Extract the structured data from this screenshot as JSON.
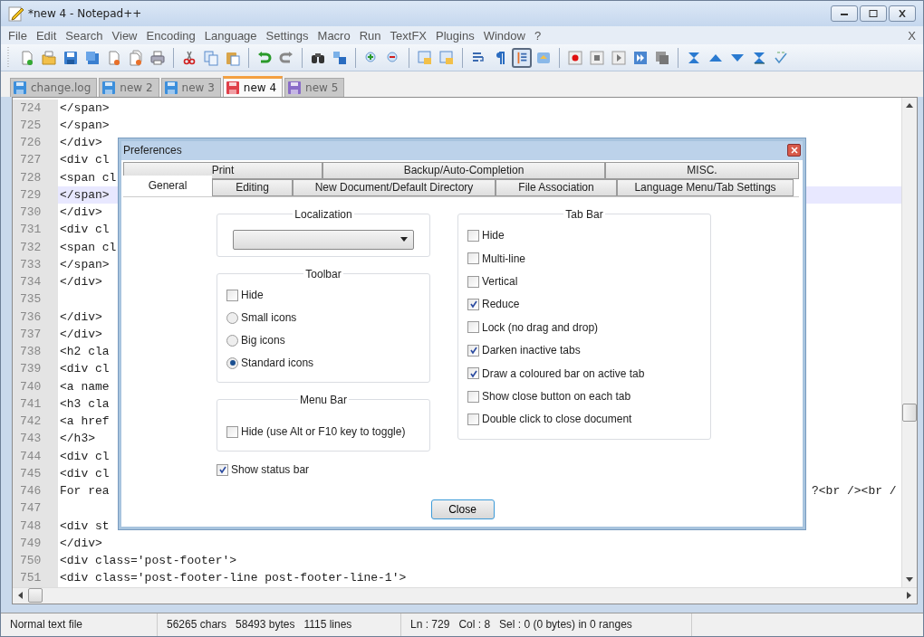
{
  "window": {
    "title": "*new 4 - Notepad++"
  },
  "menu": [
    "File",
    "Edit",
    "Search",
    "View",
    "Encoding",
    "Language",
    "Settings",
    "Macro",
    "Run",
    "TextFX",
    "Plugins",
    "Window",
    "?"
  ],
  "menu_close": "X",
  "toolbar": [
    {
      "kind": "button",
      "pressed": false
    },
    {
      "kind": "button",
      "pressed": false
    },
    {
      "kind": "button",
      "pressed": false
    },
    {
      "kind": "button",
      "pressed": false
    },
    {
      "kind": "button",
      "pressed": false
    },
    {
      "kind": "button",
      "pressed": false
    },
    {
      "kind": "button",
      "pressed": false
    },
    {
      "kind": "separator"
    },
    {
      "kind": "button",
      "pressed": false
    },
    {
      "kind": "button",
      "pressed": false
    },
    {
      "kind": "button",
      "pressed": false
    },
    {
      "kind": "separator"
    },
    {
      "kind": "button",
      "pressed": false
    },
    {
      "kind": "button",
      "pressed": false
    },
    {
      "kind": "separator"
    },
    {
      "kind": "button",
      "pressed": false
    },
    {
      "kind": "button",
      "pressed": false
    },
    {
      "kind": "separator"
    },
    {
      "kind": "button",
      "pressed": false
    },
    {
      "kind": "button",
      "pressed": false
    },
    {
      "kind": "separator"
    },
    {
      "kind": "button",
      "pressed": false
    },
    {
      "kind": "button",
      "pressed": false
    },
    {
      "kind": "separator"
    },
    {
      "kind": "button",
      "pressed": false
    },
    {
      "kind": "button",
      "pressed": false
    },
    {
      "kind": "button",
      "pressed": true
    },
    {
      "kind": "button",
      "pressed": false
    },
    {
      "kind": "separator"
    },
    {
      "kind": "button",
      "pressed": false
    },
    {
      "kind": "button",
      "pressed": false
    },
    {
      "kind": "button",
      "pressed": false
    },
    {
      "kind": "button",
      "pressed": false
    },
    {
      "kind": "button",
      "pressed": false
    },
    {
      "kind": "separator"
    },
    {
      "kind": "button",
      "pressed": false
    },
    {
      "kind": "button",
      "pressed": false
    },
    {
      "kind": "button",
      "pressed": false
    },
    {
      "kind": "button",
      "pressed": false
    },
    {
      "kind": "button",
      "pressed": false
    }
  ],
  "tabs": [
    {
      "label": "change.log",
      "selected": false,
      "color": "#3c8fdc"
    },
    {
      "label": "new  2",
      "selected": false,
      "color": "#3c8fdc"
    },
    {
      "label": "new  3",
      "selected": false,
      "color": "#3c8fdc"
    },
    {
      "label": "new  4",
      "selected": true,
      "color": "#e0404a"
    },
    {
      "label": "new  5",
      "selected": false,
      "color": "#8a6cc8"
    }
  ],
  "editor": {
    "lines": [
      {
        "number": "724",
        "text": "</span>",
        "current": false
      },
      {
        "number": "725",
        "text": "</span>",
        "current": false
      },
      {
        "number": "726",
        "text": "</div>",
        "current": false
      },
      {
        "number": "727",
        "text": "<div cl",
        "current": false
      },
      {
        "number": "728",
        "text": "<span cl",
        "current": false
      },
      {
        "number": "729",
        "text": "</span>",
        "current": true
      },
      {
        "number": "730",
        "text": "</div>",
        "current": false
      },
      {
        "number": "731",
        "text": "<div cl",
        "current": false
      },
      {
        "number": "732",
        "text": "<span cl",
        "current": false
      },
      {
        "number": "733",
        "text": "</span>",
        "current": false
      },
      {
        "number": "734",
        "text": "</div>",
        "current": false
      },
      {
        "number": "735",
        "current": false
      },
      {
        "number": "736",
        "text": "</div>",
        "current": false
      },
      {
        "number": "737",
        "text": "</div>",
        "current": false
      },
      {
        "number": "738",
        "text": "<h2 cla",
        "current": false
      },
      {
        "number": "739",
        "text": "<div cl",
        "current": false
      },
      {
        "number": "740",
        "text": "<a name",
        "current": false
      },
      {
        "number": "741",
        "text": "<h3 cla",
        "current": false
      },
      {
        "number": "742",
        "text": "<a href",
        "current": false
      },
      {
        "number": "743",
        "text": "</h3>",
        "current": false
      },
      {
        "number": "744",
        "text": "<div cl",
        "current": false
      },
      {
        "number": "745",
        "text": "<div cl",
        "current": false
      },
      {
        "number": "746",
        "text": "For rea",
        "tail": "?<br /><br /",
        "current": false
      },
      {
        "number": "747",
        "current": false
      },
      {
        "number": "748",
        "text": "<div st",
        "current": false
      },
      {
        "number": "749",
        "text": "</div>",
        "current": false
      },
      {
        "number": "750",
        "text": "<div class='post-footer'>",
        "current": false
      },
      {
        "number": "751",
        "text": "<div class='post-footer-line post-footer-line-1'>",
        "current": false
      }
    ]
  },
  "status_bar": [
    [
      "Normal text file"
    ],
    [
      "56265 chars",
      "58493 bytes",
      "1115 lines"
    ],
    [
      "Ln : 729",
      "Col : 8",
      "Sel : 0 (0 bytes) in 0 ranges"
    ]
  ],
  "dialog": {
    "title": "Preferences",
    "tab_rows": [
      [
        {
          "label": "Print",
          "selected": false
        },
        {
          "label": "Backup/Auto-Completion",
          "selected": false
        },
        {
          "label": "MISC.",
          "selected": false
        }
      ],
      [
        {
          "label": "General",
          "selected": true
        },
        {
          "label": "Editing",
          "selected": false
        },
        {
          "label": "New Document/Default Directory",
          "selected": false
        },
        {
          "label": "File Association",
          "selected": false
        },
        {
          "label": "Language Menu/Tab Settings",
          "selected": false
        }
      ]
    ],
    "localization": {
      "title": "Localization"
    },
    "toolbar_group": {
      "title": "Toolbar",
      "options": [
        {
          "kind": "checkbox",
          "label": "Hide",
          "checked": false
        },
        {
          "kind": "radio",
          "label": "Small icons",
          "selected": false
        },
        {
          "kind": "radio",
          "label": "Big icons",
          "selected": false
        },
        {
          "kind": "radio",
          "label": "Standard icons",
          "selected": true
        }
      ]
    },
    "menu_bar_group": {
      "title": "Menu Bar",
      "options": [
        {
          "label": "Hide (use Alt or F10 key to toggle)",
          "checked": false
        }
      ]
    },
    "show_status_bar": {
      "label": "Show status bar",
      "checked": true
    },
    "tab_bar_group": {
      "title": "Tab Bar",
      "options": [
        {
          "label": "Hide",
          "checked": false
        },
        {
          "label": "Multi-line",
          "checked": false
        },
        {
          "label": "Vertical",
          "checked": false
        },
        {
          "label": "Reduce",
          "checked": true
        },
        {
          "label": "Lock (no drag and drop)",
          "checked": false
        },
        {
          "label": "Darken inactive tabs",
          "checked": true
        },
        {
          "label": "Draw a coloured bar on active tab",
          "checked": true
        },
        {
          "label": "Show close button on each tab",
          "checked": false
        },
        {
          "label": "Double click to close document",
          "checked": false
        }
      ]
    },
    "close_button": "Close"
  }
}
